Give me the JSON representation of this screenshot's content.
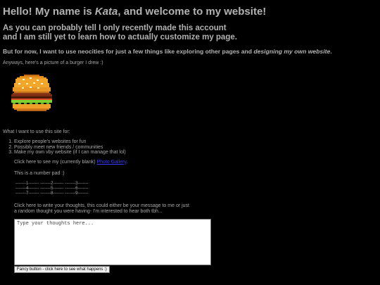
{
  "header": {
    "title_part1": "Hello! My name is ",
    "title_name": "Kata",
    "title_part2": ", and welcome to my website!",
    "subtitle_line1": "As you can probably tell I only recently made this account",
    "subtitle_line2": "and I am still yet to learn how to actually customize my page."
  },
  "intro": {
    "text_part1": "But for now, I want to use neocities for just a few things like exploring other pages and ",
    "text_emphasis": "designing my own website",
    "text_part2": "."
  },
  "burger": {
    "caption": "Anyways, here's a picture of a burger I drew :)"
  },
  "goals": {
    "heading": "What I want to use this site for:",
    "items": [
      "Explore people's websites for fun",
      "Possibly meet new friends / communities",
      "Make my own vby website (if I can manage that lol)"
    ]
  },
  "gallery": {
    "text": "Click here to see my (currently blank) ",
    "link_label": "Photo Gallery",
    "text_after": "."
  },
  "numberpad": {
    "label": "This is a number pad :)",
    "rows": [
      "-------1------- -------2------- -------3-------",
      "-------4------- -------5------- -------6-------",
      "-------7------- -------8------- -------9-------"
    ]
  },
  "thoughts": {
    "line1": "Click here to write your thoughts, this could either be your message to me or just",
    "line2": "a random thought you were having- I'm interested to hear both tbh...",
    "placeholder": "Type your thoughts here...",
    "button_label": "Fancy button - click here to see what happens :)"
  },
  "colors": {
    "background": "#000000",
    "text": "#a8a8a8",
    "link": "#3b3bff"
  }
}
